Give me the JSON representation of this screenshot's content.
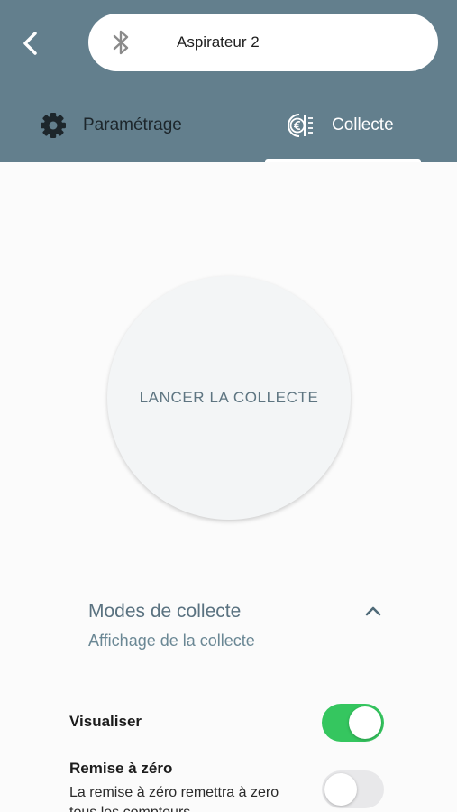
{
  "header": {
    "back_icon": "chevron-left-icon",
    "device_icon": "bluetooth-icon",
    "device_name": "Aspirateur 2"
  },
  "tabs": [
    {
      "label": "Paramétrage",
      "icon": "gear-icon",
      "active": false
    },
    {
      "label": "Collecte",
      "icon": "euro-display-icon",
      "active": true
    }
  ],
  "launch": {
    "label": "LANCER LA COLLECTE"
  },
  "modes": {
    "title": "Modes de collecte",
    "subtitle": "Affichage de la collecte",
    "expanded": true
  },
  "settings": [
    {
      "label": "Visualiser",
      "enabled": true
    },
    {
      "label": "Remise à zéro",
      "description": "La remise à zéro remettra à zero tous les compteurs",
      "enabled": false
    }
  ],
  "colors": {
    "header_bg": "#637f8d",
    "toggle_on": "#35c65f",
    "toggle_off": "#e8e8ea",
    "accent_text": "#5a7280"
  }
}
